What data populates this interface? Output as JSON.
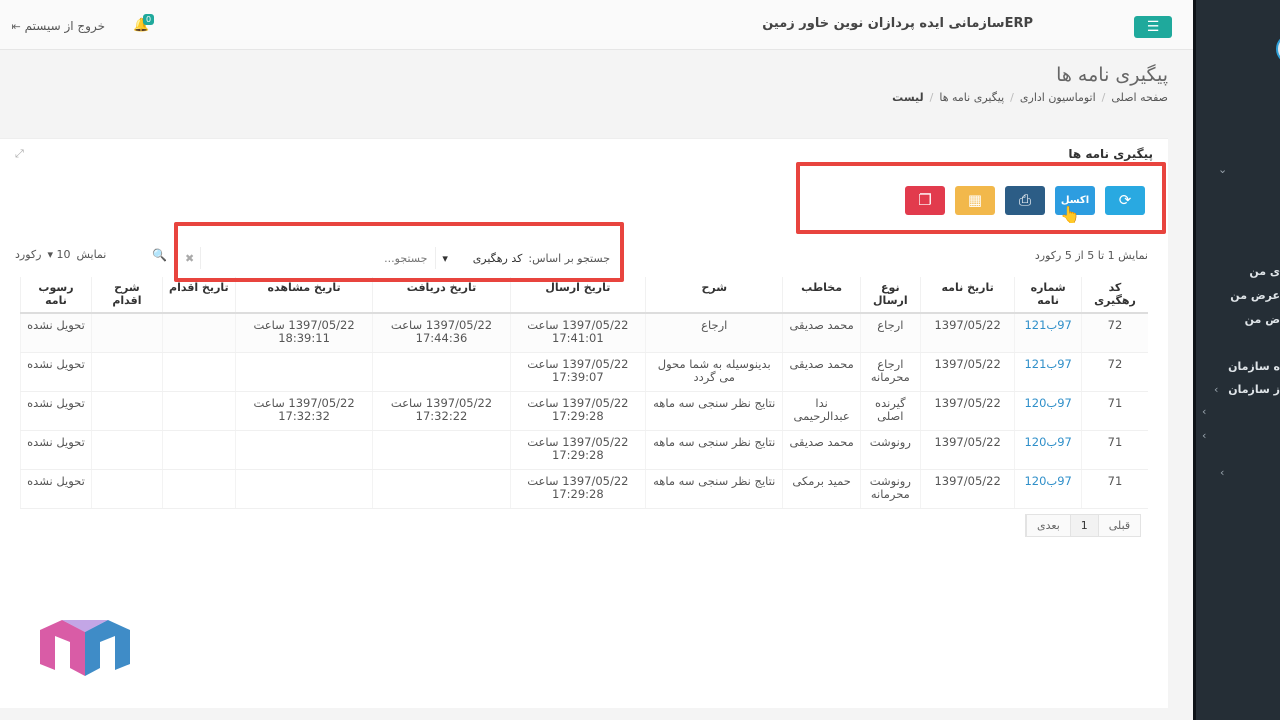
{
  "topbar": {
    "org_name": "ERPسازمانی ایده پردازان نوین خاور زمین",
    "logout_label": "خروج از سیستم",
    "notification_count": "0"
  },
  "sidebar": {
    "items": [
      "ی من",
      "عرض من",
      "ض من",
      "ه سازمان",
      "ز سازمان"
    ]
  },
  "page": {
    "title": "پیگیری نامه ها",
    "breadcrumb": [
      "صفحه اصلی",
      "اتوماسیون اداری",
      "پیگیری نامه ها",
      "لیست"
    ]
  },
  "panel": {
    "title": "پیگیری نامه ها",
    "excel_label": "اکسل",
    "info": "نمایش 1 تا 5 از 5 رکورد",
    "search_label": "جستجو بر اساس:",
    "search_field": "کد رهگیری",
    "search_placeholder": "جستجو...",
    "page_size_prefix": "نمایش",
    "page_size": "10",
    "page_size_suffix": "رکورد"
  },
  "table": {
    "headers": [
      "کد رهگیری",
      "شماره نامه",
      "تاریخ نامه",
      "نوع ارسال",
      "مخاطب",
      "شرح",
      "تاریخ ارسال",
      "تاریخ دریافت",
      "تاریخ مشاهده",
      "تاریخ اقدام",
      "شرح اقدام",
      "رسوب نامه"
    ],
    "rows": [
      [
        "72",
        "97ب121",
        "1397/05/22",
        "ارجاع",
        "محمد صدیقی",
        "ارجاع",
        "1397/05/22 ساعت 17:41:01",
        "1397/05/22 ساعت 17:44:36",
        "1397/05/22 ساعت 18:39:11",
        "",
        "",
        "تحویل نشده"
      ],
      [
        "72",
        "97ب121",
        "1397/05/22",
        "ارجاع محرمانه",
        "محمد صدیقی",
        "بدینوسیله به شما محول می گردد",
        "1397/05/22 ساعت 17:39:07",
        "",
        "",
        "",
        "",
        "تحویل نشده"
      ],
      [
        "71",
        "97ب120",
        "1397/05/22",
        "گیرنده اصلی",
        "ندا عبدالرحیمی",
        "نتایج نظر سنجی سه ماهه",
        "1397/05/22 ساعت 17:29:28",
        "1397/05/22 ساعت 17:32:22",
        "1397/05/22 ساعت 17:32:32",
        "",
        "",
        "تحویل نشده"
      ],
      [
        "71",
        "97ب120",
        "1397/05/22",
        "رونوشت",
        "محمد صدیقی",
        "نتایج نظر سنجی سه ماهه",
        "1397/05/22 ساعت 17:29:28",
        "",
        "",
        "",
        "",
        "تحویل نشده"
      ],
      [
        "71",
        "97ب120",
        "1397/05/22",
        "رونوشت محرمانه",
        "حمید برمکی",
        "نتایج نظر سنجی سه ماهه",
        "1397/05/22 ساعت 17:29:28",
        "",
        "",
        "",
        "",
        "تحویل نشده"
      ]
    ]
  },
  "pagination": {
    "prev": "قبلی",
    "current": "1",
    "next": "بعدی"
  }
}
